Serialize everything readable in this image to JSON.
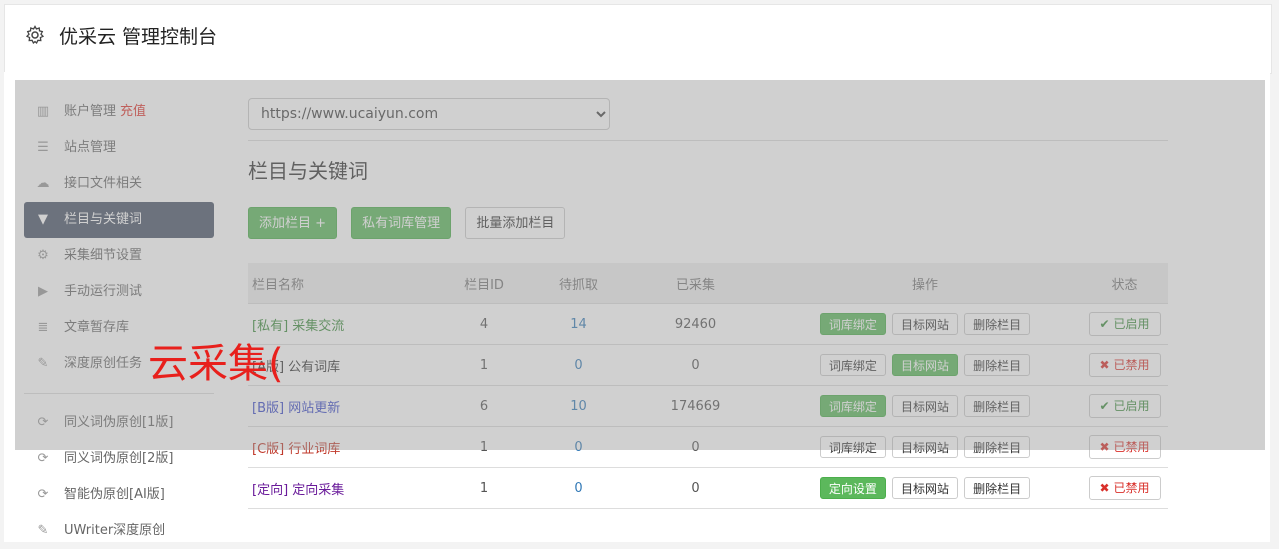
{
  "header": {
    "title": "优采云 管理控制台",
    "icon": "gear-icon"
  },
  "sidebar": {
    "items": [
      {
        "label": "账户管理",
        "extra": "充值",
        "icon": "bar-chart-icon",
        "glyph": "▥"
      },
      {
        "label": "站点管理",
        "icon": "server-icon",
        "glyph": "☰"
      },
      {
        "label": "接口文件相关",
        "icon": "cloud-upload-icon",
        "glyph": "☁"
      },
      {
        "label": "栏目与关键词",
        "icon": "filter-icon",
        "glyph": "▼"
      },
      {
        "label": "采集细节设置",
        "icon": "cogs-icon",
        "glyph": "⚙"
      },
      {
        "label": "手动运行测试",
        "icon": "play-circle-icon",
        "glyph": "▶"
      },
      {
        "label": "文章暂存库",
        "icon": "database-icon",
        "glyph": "≣"
      },
      {
        "label": "深度原创任务",
        "icon": "edit-icon",
        "glyph": "✎"
      },
      {
        "label": "同义词伪原创[1版]",
        "icon": "refresh-icon",
        "glyph": "⟳"
      },
      {
        "label": "同义词伪原创[2版]",
        "icon": "refresh-icon",
        "glyph": "⟳"
      },
      {
        "label": "智能伪原创[AI版]",
        "icon": "refresh-icon",
        "glyph": "⟳"
      },
      {
        "label": "UWriter深度原创",
        "icon": "edit-icon",
        "glyph": "✎"
      }
    ]
  },
  "main": {
    "site_select": {
      "value": "https://www.ucaiyun.com"
    },
    "section_title": "栏目与关键词",
    "buttons": {
      "add": "添加栏目 +",
      "private_lib": "私有词库管理",
      "batch_add": "批量添加栏目"
    },
    "table": {
      "headers": {
        "name": "栏目名称",
        "id": "栏目ID",
        "pending": "待抓取",
        "collected": "已采集",
        "ops": "操作",
        "status": "状态"
      },
      "rows": [
        {
          "name": "[私有] 采集交流",
          "id": "4",
          "pending": "14",
          "collected": "92460",
          "op1": "词库绑定",
          "op2": "目标网站",
          "op3": "删除栏目",
          "status": "已启用",
          "status_icon": "✔"
        },
        {
          "name": "[A版] 公有词库",
          "id": "1",
          "pending": "0",
          "collected": "0",
          "op1": "词库绑定",
          "op2": "目标网站",
          "op3": "删除栏目",
          "status": "已禁用",
          "status_icon": "✖"
        },
        {
          "name": "[B版] 网站更新",
          "id": "6",
          "pending": "10",
          "collected": "174669",
          "op1": "词库绑定",
          "op2": "目标网站",
          "op3": "删除栏目",
          "status": "已启用",
          "status_icon": "✔"
        },
        {
          "name": "[C版] 行业词库",
          "id": "1",
          "pending": "0",
          "collected": "0",
          "op1": "词库绑定",
          "op2": "目标网站",
          "op3": "删除栏目",
          "status": "已禁用",
          "status_icon": "✖"
        },
        {
          "name": "[定向] 定向采集",
          "id": "1",
          "pending": "0",
          "collected": "0",
          "op1": "定向设置",
          "op2": "目标网站",
          "op3": "删除栏目",
          "status": "已禁用",
          "status_icon": "✖"
        }
      ]
    }
  },
  "watermark": "云采集("
}
